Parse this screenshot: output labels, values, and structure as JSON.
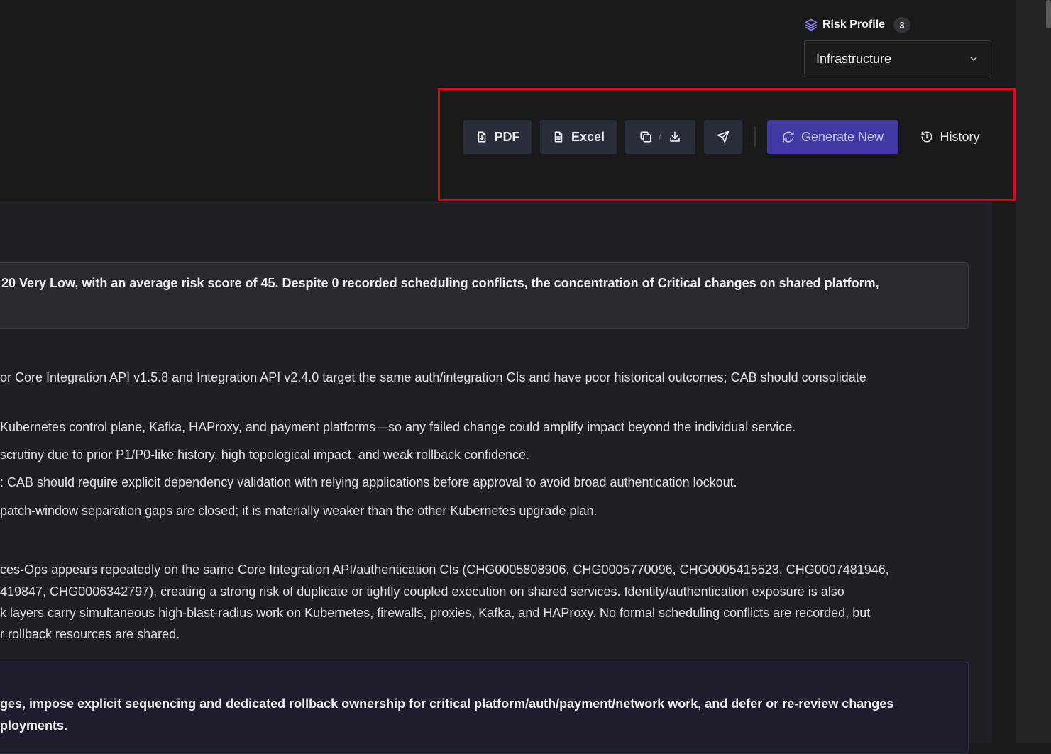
{
  "risk_profile": {
    "label": "Risk Profile",
    "count": "3",
    "selected": "Infrastructure"
  },
  "toolbar": {
    "pdf_label": "PDF",
    "excel_label": "Excel",
    "copy_download_separator": "/",
    "generate_label": "Generate New",
    "history_label": "History"
  },
  "summary": "20 Very Low, with an average risk score of 45. Despite 0 recorded scheduling conflicts, the concentration of Critical changes on shared platform,",
  "findings": [
    "or Core Integration API v1.5.8 and Integration API v2.4.0 target the same auth/integration CIs and have poor historical outcomes; CAB should consolidate",
    "Kubernetes control plane, Kafka, HAProxy, and payment platforms—so any failed change could amplify impact beyond the individual service.",
    "scrutiny due to prior P1/P0-like history, high topological impact, and weak rollback confidence.",
    ": CAB should require explicit dependency validation with relying applications before approval to avoid broad authentication lockout.",
    "patch-window separation gaps are closed; it is materially weaker than the other Kubernetes upgrade plan."
  ],
  "conflicts": [
    "ces-Ops appears repeatedly on the same Core Integration API/authentication CIs (CHG0005808906, CHG0005770096, CHG0005415523, CHG0007481946,",
    "419847, CHG0006342797), creating a strong risk of duplicate or tightly coupled execution on shared services. Identity/authentication exposure is also",
    "k layers carry simultaneous high-blast-radius work on Kubernetes, firewalls, proxies, Kafka, and HAProxy. No formal scheduling conflicts are recorded, but",
    "r rollback resources are shared."
  ],
  "recommendation": [
    "ges, impose explicit sequencing and dedicated rollback ownership for critical platform/auth/payment/network work, and defer or re-review changes",
    "ployments."
  ]
}
